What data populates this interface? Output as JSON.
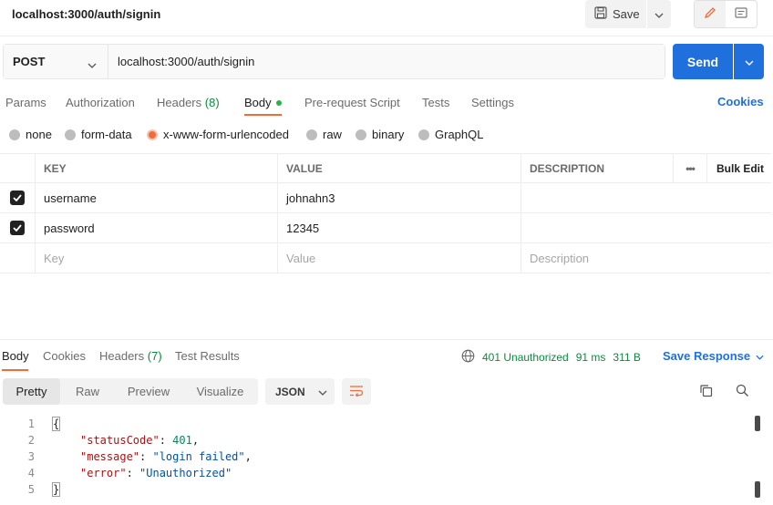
{
  "request": {
    "title": "localhost:3000/auth/signin",
    "save_label": "Save",
    "method": "POST",
    "url": "localhost:3000/auth/signin",
    "send_label": "Send"
  },
  "request_tabs": [
    {
      "label": "Params"
    },
    {
      "label": "Authorization"
    },
    {
      "label": "Headers",
      "count": "(8)"
    },
    {
      "label": "Body",
      "active": true
    },
    {
      "label": "Pre-request Script"
    },
    {
      "label": "Tests"
    },
    {
      "label": "Settings"
    }
  ],
  "cookies_label": "Cookies",
  "body_types": [
    {
      "label": "none"
    },
    {
      "label": "form-data"
    },
    {
      "label": "x-www-form-urlencoded",
      "selected": true
    },
    {
      "label": "raw"
    },
    {
      "label": "binary"
    },
    {
      "label": "GraphQL"
    }
  ],
  "kv_table": {
    "headers": {
      "key": "KEY",
      "value": "VALUE",
      "description": "DESCRIPTION",
      "more": "•••",
      "bulk_edit": "Bulk Edit"
    },
    "rows": [
      {
        "key": "username",
        "value": "johnahn3",
        "description": "",
        "checked": true
      },
      {
        "key": "password",
        "value": "12345",
        "description": "",
        "checked": true
      }
    ],
    "placeholders": {
      "key": "Key",
      "value": "Value",
      "description": "Description"
    }
  },
  "response_tabs": [
    {
      "label": "Body",
      "active": true
    },
    {
      "label": "Cookies"
    },
    {
      "label": "Headers",
      "count": "(7)"
    },
    {
      "label": "Test Results"
    }
  ],
  "response_status": {
    "status": "401 Unauthorized",
    "time": "91 ms",
    "size": "311 B",
    "save_response_label": "Save Response"
  },
  "format_tabs": [
    {
      "label": "Pretty",
      "active": true
    },
    {
      "label": "Raw"
    },
    {
      "label": "Preview"
    },
    {
      "label": "Visualize"
    }
  ],
  "language": "JSON",
  "code_lines": [
    {
      "n": "1",
      "text": "{"
    },
    {
      "n": "2",
      "key": "\"statusCode\"",
      "sep": ": ",
      "val": "401",
      "kind": "num",
      "tail": ","
    },
    {
      "n": "3",
      "key": "\"message\"",
      "sep": ": ",
      "val": "\"login failed\"",
      "kind": "str",
      "tail": ","
    },
    {
      "n": "4",
      "key": "\"error\"",
      "sep": ": ",
      "val": "\"Unauthorized\"",
      "kind": "str",
      "tail": ""
    },
    {
      "n": "5",
      "text": "}"
    }
  ],
  "colors": {
    "accent": "#1f6fdd",
    "active_tab": "#f26b3a",
    "status_green": "#0b8a3e"
  }
}
